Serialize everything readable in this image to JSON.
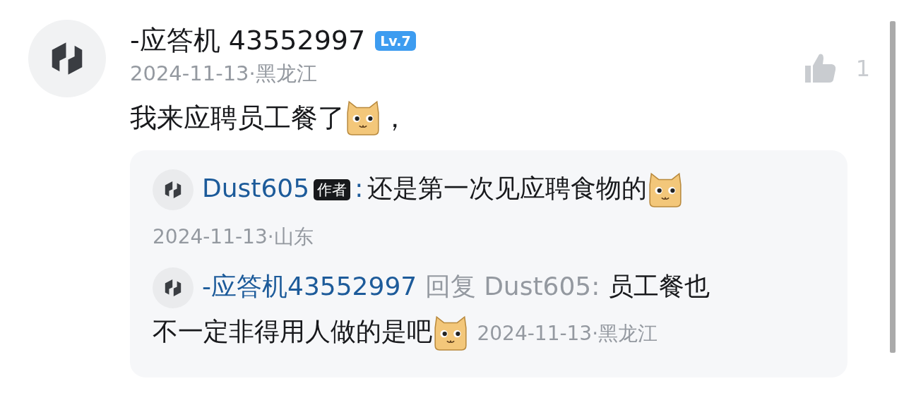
{
  "comment": {
    "author": "-应答机 43552997",
    "level_badge": "Lv.7",
    "meta": "2024-11-13·黑龙江",
    "likes": "1",
    "segments": [
      {
        "kind": "text",
        "text": "我来应聘员工餐了"
      },
      {
        "kind": "emoji"
      },
      {
        "kind": "text",
        "text": "，"
      }
    ]
  },
  "replies": [
    {
      "author": "Dust605",
      "author_badge": "作者",
      "separator": ":",
      "meta": "2024-11-13·山东",
      "meta_newline": true,
      "segments": [
        {
          "kind": "text",
          "text": "还是第一次见应聘食物的"
        },
        {
          "kind": "emoji"
        }
      ]
    },
    {
      "author": "-应答机43552997",
      "reply_word": "回复",
      "reply_to": "Dust605:",
      "meta": "2024-11-13·黑龙江",
      "meta_newline": false,
      "segments": [
        {
          "kind": "text",
          "text": "员工餐也"
        },
        {
          "kind": "text",
          "text": "不一定非得用人做的是吧"
        },
        {
          "kind": "emoji"
        }
      ]
    }
  ]
}
